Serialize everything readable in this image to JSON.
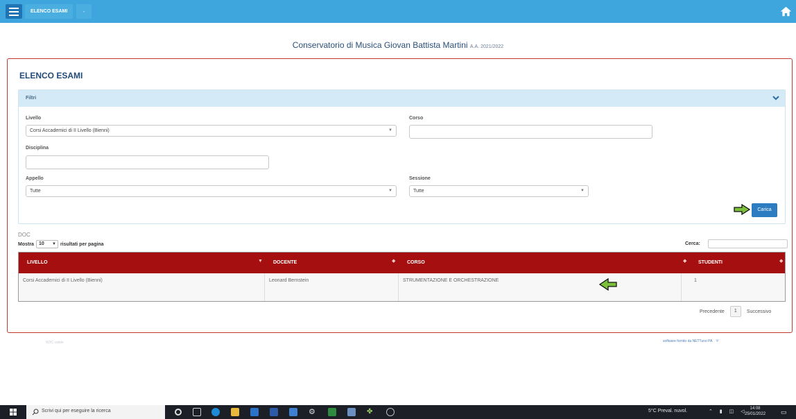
{
  "topbar": {
    "breadcrumb": "ELENCO ESAMI",
    "separator": "-"
  },
  "institution": {
    "title": "Conservatorio di Musica Giovan Battista Martini",
    "year": "A.A. 2021/2022"
  },
  "panel": {
    "title": "ELENCO ESAMI"
  },
  "filters": {
    "header": "Filtri",
    "livello": {
      "label": "Livello",
      "value": "Corsi Accademici di II Livello (Bienni)"
    },
    "corso": {
      "label": "Corso",
      "value": ""
    },
    "disciplina": {
      "label": "Disciplina",
      "value": ""
    },
    "appello": {
      "label": "Appello",
      "value": "Tutte"
    },
    "sessione": {
      "label": "Sessione",
      "value": "Tutte"
    },
    "load_button": "Carica"
  },
  "list": {
    "doc_label": "DOC",
    "show_prefix": "Mostra",
    "page_length": "10",
    "show_suffix": "risultati per pagina",
    "search_label": "Cerca:",
    "columns": [
      "LIVELLO",
      "DOCENTE",
      "CORSO",
      "STUDENTI"
    ],
    "rows": [
      {
        "livello": "Corsi Accademici di II Livello (Bienni)",
        "docente": "Leonard Bernstein",
        "corso": "STRUMENTAZIONE E ORCHESTRAZIONE",
        "studenti": "1"
      }
    ],
    "pagination": {
      "previous": "Precedente",
      "current": "1",
      "next": "Successivo"
    }
  },
  "footer": {
    "left": "W3C valido",
    "right": "software fornito da NETTuno PA"
  },
  "taskbar": {
    "search_placeholder": "Scrivi qui per eseguire la ricerca",
    "weather": "5°C Preval. nuvol.",
    "time": "14:08",
    "date": "25/01/2022"
  },
  "colors": {
    "topbar": "#3ea6dc",
    "table_header": "#a50f0f",
    "button": "#2d7bc0",
    "arrow": "#7cbf3b"
  }
}
